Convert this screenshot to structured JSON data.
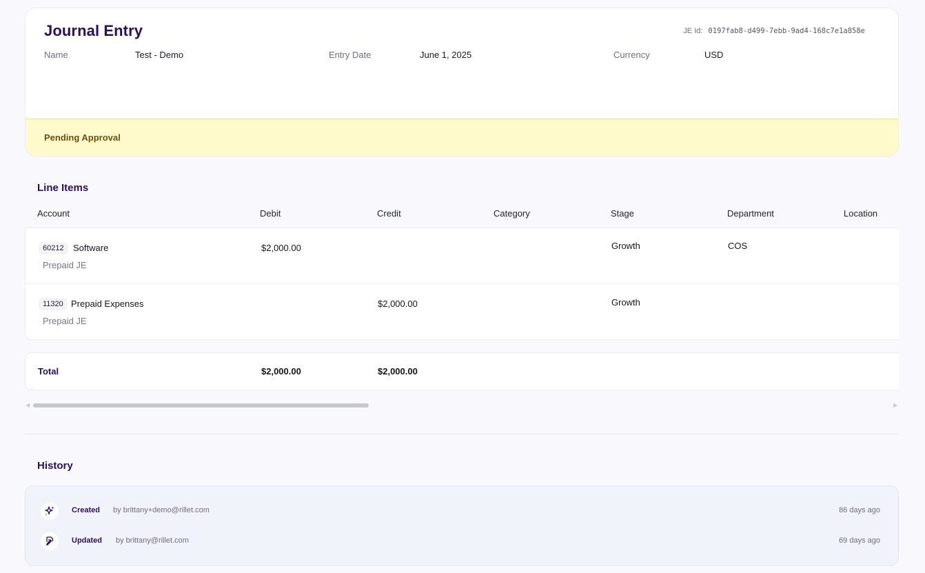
{
  "header": {
    "title": "Journal Entry",
    "je_id_label": "JE Id:",
    "je_id_value": "0197fab8-d499-7ebb-9ad4-168c7e1a858e",
    "fields": {
      "name_label": "Name",
      "name_value": "Test - Demo",
      "date_label": "Entry Date",
      "date_value": "June 1, 2025",
      "currency_label": "Currency",
      "currency_value": "USD"
    },
    "status": "Pending Approval"
  },
  "line_items": {
    "title": "Line Items",
    "columns": [
      "Account",
      "Debit",
      "Credit",
      "Category",
      "Stage",
      "Department",
      "Location"
    ],
    "rows": [
      {
        "code": "60212",
        "account": "Software",
        "memo": "Prepaid JE",
        "debit": "$2,000.00",
        "credit": "",
        "category": "",
        "stage": "Growth",
        "department": "COS",
        "location": ""
      },
      {
        "code": "11320",
        "account": "Prepaid Expenses",
        "memo": "Prepaid JE",
        "debit": "",
        "credit": "$2,000.00",
        "category": "",
        "stage": "Growth",
        "department": "",
        "location": ""
      }
    ],
    "total": {
      "label": "Total",
      "debit": "$2,000.00",
      "credit": "$2,000.00"
    }
  },
  "history": {
    "title": "History",
    "events": [
      {
        "icon": "sparkle-icon",
        "action": "Created",
        "by": "by brittany+demo@rillet.com",
        "time": "86 days ago"
      },
      {
        "icon": "document-edit-icon",
        "action": "Updated",
        "by": "by brittany@rillet.com",
        "time": "69 days ago"
      }
    ]
  }
}
